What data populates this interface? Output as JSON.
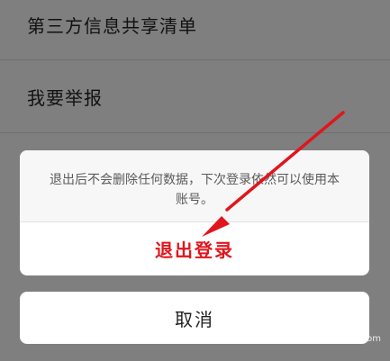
{
  "settings": {
    "items": [
      {
        "label": "第三方信息共享清单"
      },
      {
        "label": "我要举报"
      }
    ]
  },
  "dialog": {
    "message": "退出后不会删除任何数据，下次登录依然可以使用本账号。",
    "confirm_label": "退出登录",
    "cancel_label": "取消"
  },
  "annotation": {
    "arrow_color": "#e0161d"
  },
  "watermark": {
    "text": "jingyan.baidu.com"
  },
  "colors": {
    "overlay": "#7f7f7f",
    "accent": "#e0161d",
    "dialog_background": "#ffffff"
  }
}
